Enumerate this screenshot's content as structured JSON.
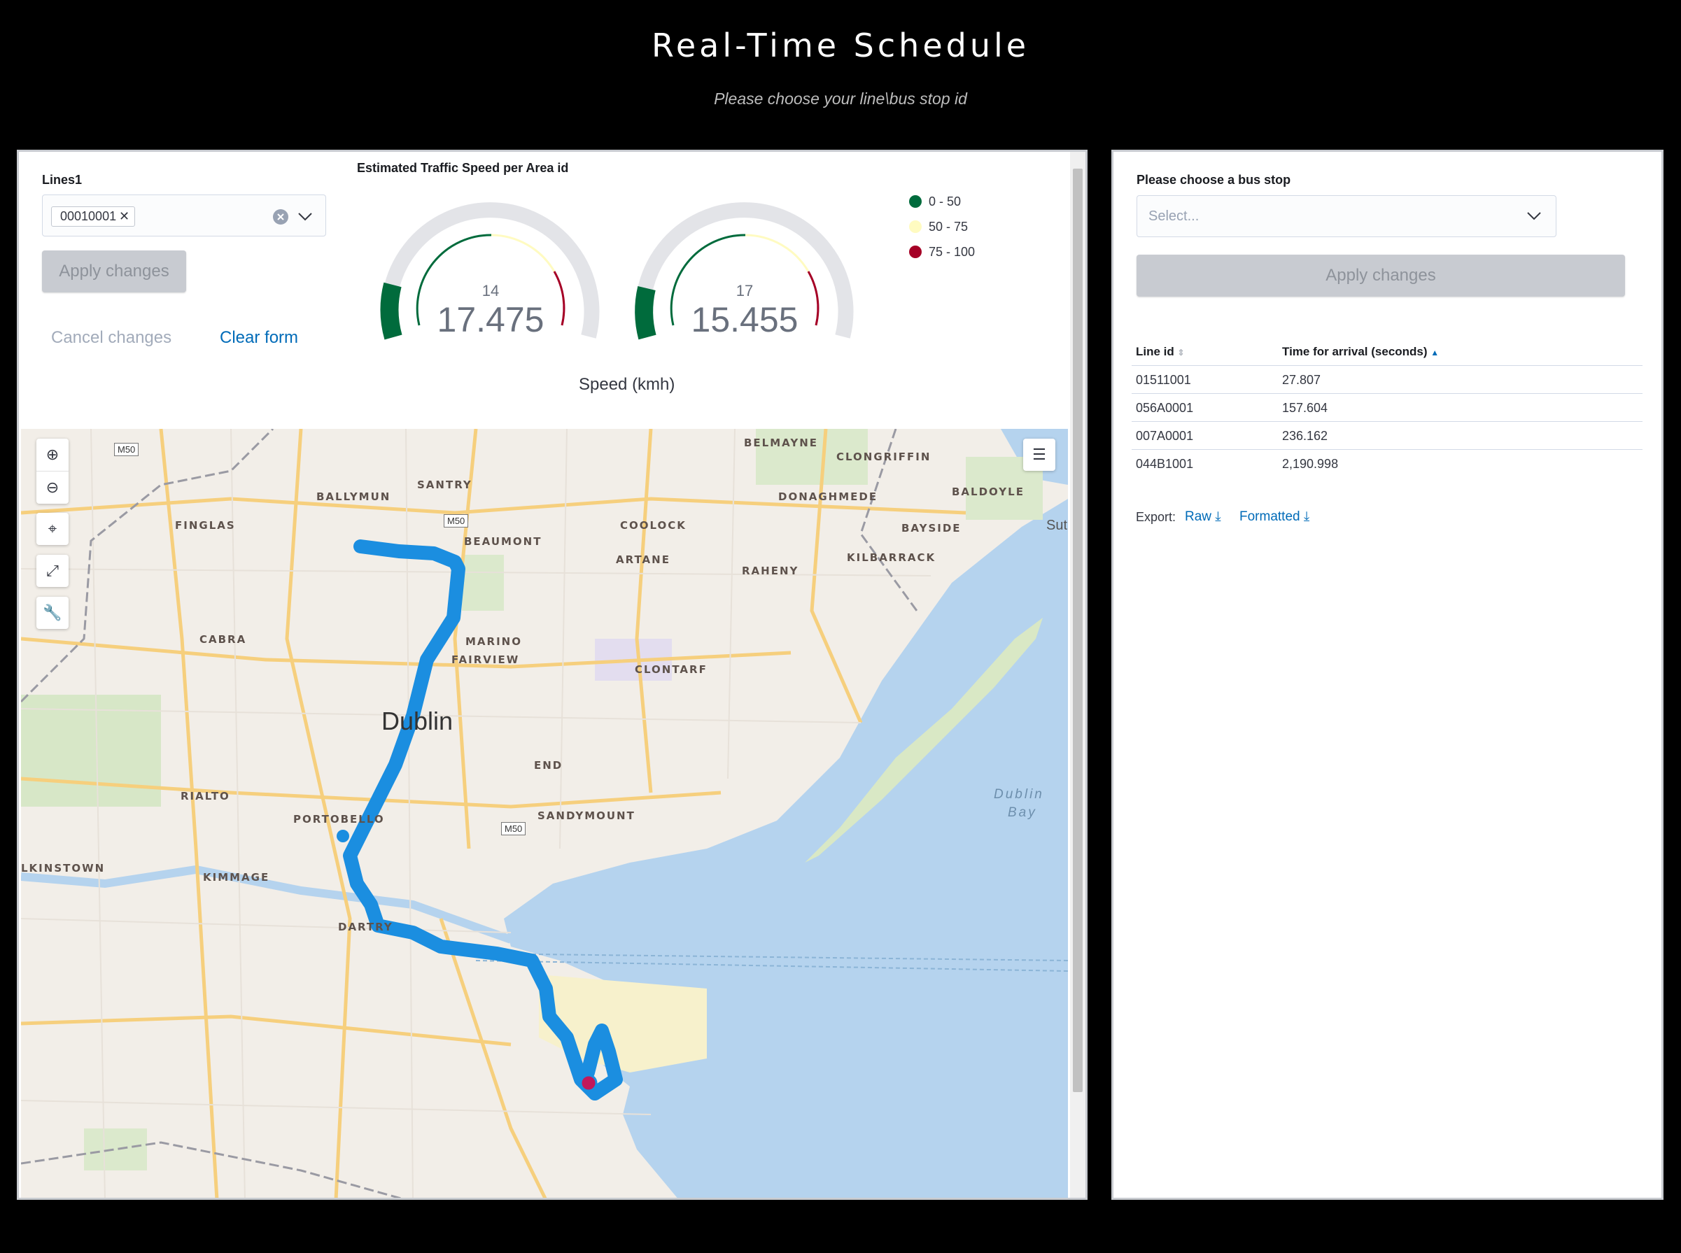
{
  "header": {
    "title": "Real-Time Schedule",
    "subtitle": "Please choose your line\\bus stop id"
  },
  "left_panel": {
    "lines_label": "Lines1",
    "selected_line": "00010001",
    "apply_label": "Apply changes",
    "cancel_label": "Cancel changes",
    "clear_label": "Clear form"
  },
  "gauges": {
    "title": "Estimated Traffic Speed per Area id",
    "axis_label": "Speed (kmh)",
    "items": [
      {
        "area_id": "14",
        "value": "17.475",
        "speed": 17.475
      },
      {
        "area_id": "17",
        "value": "15.455",
        "speed": 15.455
      }
    ],
    "legend": [
      {
        "label": "0 - 50",
        "color": "#006b3c"
      },
      {
        "label": "50 - 75",
        "color": "#fffbc1"
      },
      {
        "label": "75 - 100",
        "color": "#a50026"
      }
    ]
  },
  "map": {
    "places": {
      "belmayne": "BELMAYNE",
      "clongriffin": "CLONGRIFFIN",
      "santry": "SANTRY",
      "ballymun": "BALLYMUN",
      "donaghmede": "DONAGHMEDE",
      "baldoyle": "BALDOYLE",
      "finglas": "FINGLAS",
      "coolock": "COOLOCK",
      "beaumont": "BEAUMONT",
      "bayside": "BAYSIDE",
      "sut": "Sut",
      "artane": "ARTANE",
      "kilbarrack": "KILBARRACK",
      "raheny": "RAHENY",
      "cabra": "CABRA",
      "marino": "MARINO",
      "fairview": "FAIRVIEW",
      "clontarf": "CLONTARF",
      "dublin": "Dublin",
      "end": "END",
      "rialto": "RIALTO",
      "portobello": "PORTOBELLO",
      "sandymount": "SANDYMOUNT",
      "dublin_bay_1": "Dublin",
      "dublin_bay_2": "Bay",
      "walkinstown": "LKINSTOWN",
      "kimmage": "KIMMAGE",
      "dartry": "DARTRY"
    },
    "road_shields": {
      "m50_a": "M50",
      "m50_b": "M50",
      "m50_c": "M50"
    },
    "route_color": "#1b8ee0",
    "stop_color": "#c2185b"
  },
  "right_panel": {
    "stop_label": "Please choose a bus stop",
    "stop_placeholder": "Select...",
    "apply_label": "Apply changes",
    "columns": {
      "line_id": "Line id",
      "time": "Time for arrival (seconds)"
    },
    "rows": [
      {
        "line_id": "01511001",
        "time": "27.807"
      },
      {
        "line_id": "056A0001",
        "time": "157.604"
      },
      {
        "line_id": "007A0001",
        "time": "236.162"
      },
      {
        "line_id": "044B1001",
        "time": "2,190.998"
      }
    ],
    "export_label": "Export:",
    "export_raw": "Raw",
    "export_formatted": "Formatted"
  }
}
